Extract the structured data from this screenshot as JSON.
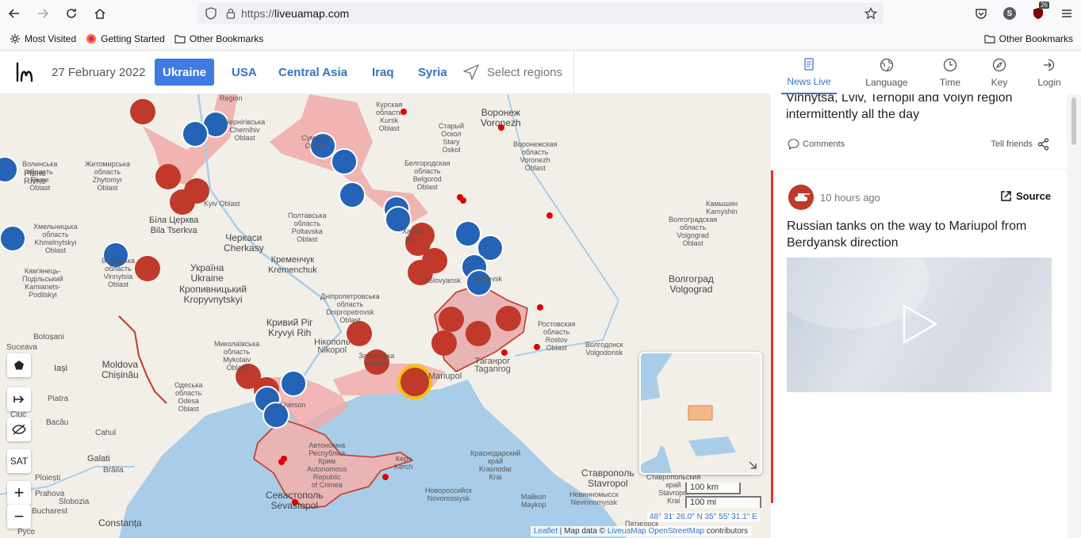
{
  "browser": {
    "url_prefix": "https://",
    "url_host": "liveuamap.com",
    "ext_badge": "26",
    "avatar_letter": "S",
    "bookmarks": [
      "Most Visited",
      "Getting Started",
      "Other Bookmarks"
    ],
    "bookmarks_right": "Other Bookmarks"
  },
  "header": {
    "date": "27 February 2022",
    "tabs": [
      "Ukraine",
      "USA",
      "Central Asia",
      "Iraq",
      "Syria"
    ],
    "active_tab": "Ukraine",
    "select_regions": "Select regions"
  },
  "panel": {
    "tabs": [
      "News Live",
      "Language",
      "Time",
      "Key",
      "Login"
    ],
    "post1": {
      "text": "Vinnytsa, Lviv, Ternopil and Volyn region intermittently all the day",
      "comments": "Comments",
      "tell_friends": "Tell friends"
    },
    "post2": {
      "time": "10 hours ago",
      "source": "Source",
      "text": "Russian tanks on the way to Mariupol from Berdyansk direction"
    }
  },
  "map": {
    "colors": {
      "water": "#a9cde8",
      "land": "#f2efe9",
      "occupied": "#f0a9a9",
      "occupied_border": "#c0392b",
      "red_marker": "#c0392b",
      "blue_marker": "#2463b5"
    },
    "cities": [
      {
        "t": "Черкаси\nCherkasy",
        "cls": "city"
      },
      {
        "t": "Україна\nUkraine",
        "cls": "city"
      },
      {
        "t": "Кропивницький\nKropyvnytskyi",
        "cls": "city"
      },
      {
        "t": "Кривий Ріг\nKryvyi Rih",
        "cls": "city"
      },
      {
        "t": "Кременчук\nKremenchuk",
        "cls": "city"
      },
      {
        "t": "Біла Церква\nBila Tserkva",
        "cls": "city"
      },
      {
        "t": "Воронеж\nVoronezh",
        "cls": "city"
      },
      {
        "t": "Волгоград\nVolgograd",
        "cls": "city"
      },
      {
        "t": "Moldova\nChișinău",
        "cls": "city"
      },
      {
        "t": "Севастополь\nSevastopol",
        "cls": "city"
      },
      {
        "t": "Ставрополь\nStavropol",
        "cls": "city"
      },
      {
        "t": "Constanța",
        "cls": "city"
      },
      {
        "t": "Galati",
        "cls": "city"
      },
      {
        "t": "Iași",
        "cls": "city"
      }
    ],
    "labels": [
      "Курская\nобласть\nKursk\nOblast",
      "Старый\nОскол\nStary\nOskol",
      "Белгородская\nобласть\nBelgorod\nOblast",
      "Воронежская\nобласть\nVoronezh\nOblast",
      "Камышин\nKamyshin",
      "Волгоградская\nобласть\nVolgograd\nOblast",
      "Ростовская\nобласть\nRostov\nOblast",
      "Волгодонск\nVolgodonsk",
      "Таганрог\nTaganrog",
      "Полтавська\nобласть\nPoltavska\nOblast",
      "Дніпропетровська\nобласть\nDnipropetrovsk\nOblast",
      "Миколаївська\nобласть\nMykolaiv\nOblast",
      "Одеська\nобласть\nOdesa\nOblast",
      "Житомирська\nобласть\nZhytomyr\nOblast",
      "Хмельницька\nобласть\nKhmelnytskyi\nOblast",
      "Кам'янець-\nПодільський\nKamianets-\nPodilskyi",
      "Вінницька\nобласть\nVinnytsia\nOblast",
      "Автономна\nРеспубліка\nКрим\nAutonomous\nRepublic\nof Crimea",
      "Краснодарский\nкрай\nKrasnodar\nKrai",
      "Новороссийск\nNovorossiysk",
      "Невинномысск\nNevinnomyssk",
      "Майкоп\nMaykop",
      "Ставропольский\nкрай\nStavropol\nKrai",
      "Волинська\nобласть\nRivne\nOblast",
      "Рівне\nRivne",
      "Нікополь\nNikopol",
      "Запорізька\nOblast",
      "Mariupol",
      "Alchevsk",
      "Slovyansk",
      "Botoșani",
      "Suceava",
      "Slobozia",
      "Cahul",
      "Ciuc",
      "Brăila",
      "Piatra",
      "Bacău",
      "Kherson",
      "Керч\nKerch",
      "Сумська\nOblast",
      "Чернігівська\nChernihiv\nOblast",
      "Kyiv Oblast",
      "Region",
      "Харків\nKh...",
      "Пятигорск",
      "Prahova",
      "Ploiești",
      "Bucharest",
      "Pyce"
    ],
    "controls": [
      "SAT",
      "+",
      "−"
    ],
    "scale": [
      "100 km",
      "100 mi"
    ],
    "coords": "48° 31' 26.0\" N 35° 55' 31.1\" E",
    "attribution_leaflet": "Leaflet",
    "attribution_mid": " | Map data © ",
    "attribution_link": "LiveuaMap OpenStreetMap",
    "attribution_end": " contributors"
  }
}
